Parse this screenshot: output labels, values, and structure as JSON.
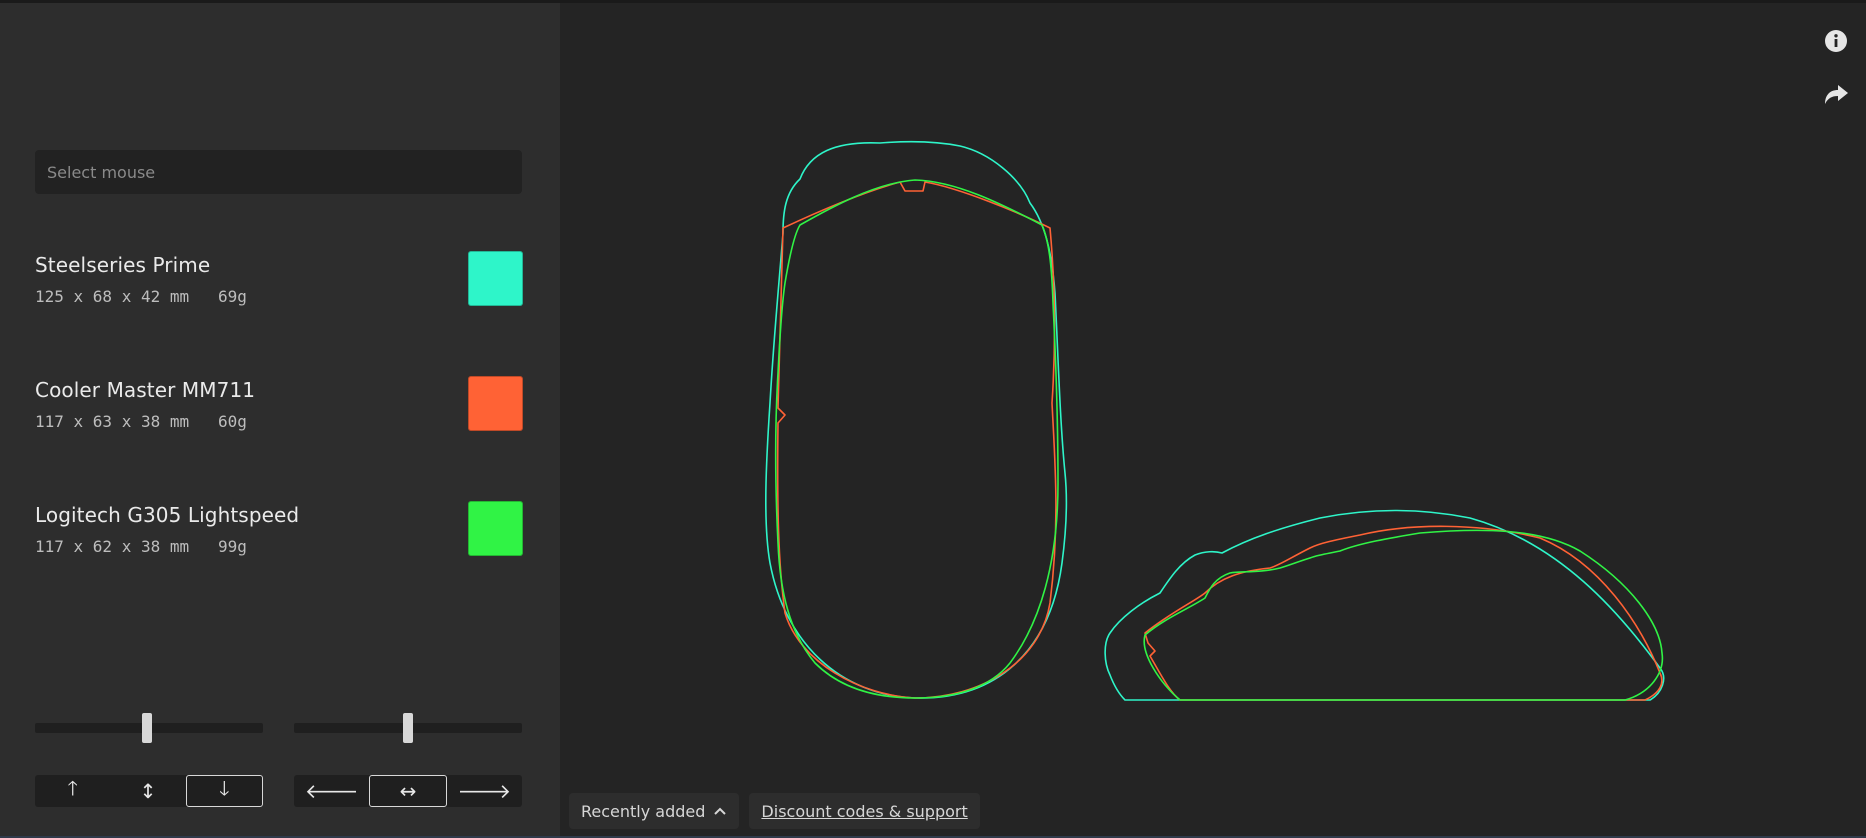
{
  "sidebar": {
    "select_placeholder": "Select mouse",
    "mice": [
      {
        "name": "Steelseries Prime",
        "spec": "125 x 68 x 42 mm   69g",
        "color": "#2ef5c9"
      },
      {
        "name": "Cooler Master MM711",
        "spec": "117 x 63 x 38 mm   60g",
        "color": "#ff6235"
      },
      {
        "name": "Logitech G305 Lightspeed",
        "spec": "117 x 62 x 38 mm   99g",
        "color": "#30f345"
      }
    ],
    "vertical_slider_value": 0.49,
    "horizontal_slider_value": 0.5,
    "vertical_align": {
      "options": [
        "up-arrow-icon",
        "vertical-double-arrow-icon",
        "down-arrow-icon"
      ],
      "glyphs": [
        "🡑",
        "↕",
        "🡓"
      ],
      "selected": "down"
    },
    "horizontal_align": {
      "options": [
        "left-arrow-icon",
        "horizontal-double-arrow-icon",
        "right-arrow-icon"
      ],
      "glyphs": [
        "🡐",
        "↔",
        "🡒"
      ],
      "selected": "center"
    }
  },
  "toolbar": {
    "icons": [
      "info-icon",
      "share-icon"
    ]
  },
  "bottom_bar": {
    "recently_added_label": "Recently added",
    "discount_label": "Discount codes & support"
  },
  "colors": {
    "background": "#242424",
    "sidebar": "#2d2d2d",
    "steelseries_outline": "#2ef5c9",
    "coolermaster_outline": "#ff6235",
    "logitech_outline": "#30f345"
  }
}
